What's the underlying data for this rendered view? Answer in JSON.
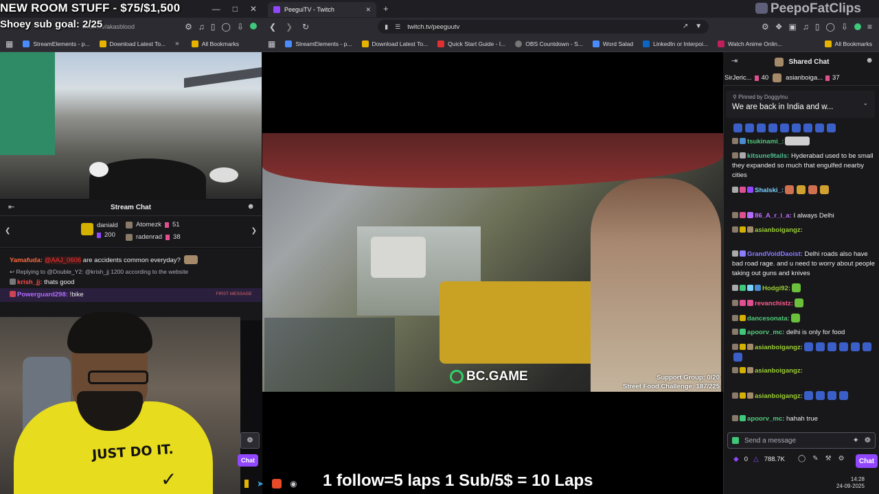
{
  "left_window": {
    "title_overlay_line1": "NEW ROOM STUFF - $75/$1,500",
    "title_overlay_line2": "Shoey sub goal: 2/25",
    "address": "twitch.tv/akasblood",
    "bookmarks": [
      "StreamElements - p...",
      "Download Latest To...",
      "All Bookmarks"
    ],
    "chat_header": "Stream Chat",
    "leaderboard": [
      {
        "name": "daniald",
        "count": "200"
      },
      {
        "name": "Atomezk",
        "count": "51"
      },
      {
        "name": "radenrad",
        "count": "38"
      }
    ],
    "messages": [
      {
        "user": "Yamafuda:",
        "mention": "@AAJ_0606",
        "text": " are accidents common everyday?",
        "user_color": "#ff6a3d"
      },
      {
        "reply": "Replying to @Double_Y2: @krish_jj 1200 according to the website"
      },
      {
        "user": "krish_jj:",
        "text": " thats good",
        "user_color": "#ff4a4a"
      },
      {
        "user": "Powerguard298:",
        "text": " !bike",
        "user_color": "#b46cff",
        "tag": "FIRST MESSAGE"
      }
    ],
    "chat_button": "Chat"
  },
  "webcam": {
    "shirt_text": "JUST DO IT."
  },
  "bottom_overlay": "1 follow=5 laps 1 Sub/5$ = 10 Laps",
  "main_window": {
    "tab_title": "PeeguiTV - Twitch",
    "address": "twitch.tv/peeguutv",
    "bookmarks": [
      "StreamElements - p...",
      "Download Latest To...",
      "Quick Start Guide - I...",
      "OBS Countdown - S...",
      "Word Salad",
      "LinkedIn or Interpoi...",
      "Watch Anime Onlin...",
      "All Bookmarks"
    ],
    "video_brand": "BC.GAME",
    "support_group": "Support Group: 0/20",
    "street_food": "Street Food Challenge: 187/225"
  },
  "watermark": "PeepoFatClips",
  "right_chat": {
    "header": "Shared Chat",
    "leaderboard": [
      {
        "name": "SirJeric...",
        "count": "40"
      },
      {
        "name": "asianboiga...",
        "count": "37"
      }
    ],
    "pinned_by": "Pinned by DoggyInu",
    "pinned_text": "We are back in India and w...",
    "messages": [
      {
        "user": "tsukinami_:",
        "text": "",
        "color": "#52c87a"
      },
      {
        "user": "kitsune9tails:",
        "text": " Hyderabad used to be small they expanded so much that engulfed nearby cities",
        "color": "#4fbf8f"
      },
      {
        "user": "Shalski_:",
        "text": "",
        "color": "#7ad3ff"
      },
      {
        "user": "86_A_r_i_a:",
        "text": " I always Delhi",
        "color": "#c26dff"
      },
      {
        "user": "asianboigangz:",
        "text": "",
        "color": "#9acd32"
      },
      {
        "user": "GrandVoidDaoist:",
        "text": " Delhi roads also have bad road rage. and u need to worry about people taking out guns and knives",
        "color": "#8a7dff"
      },
      {
        "user": "Hodgi92:",
        "text": "",
        "color": "#9acd32"
      },
      {
        "user": "revanchistz:",
        "text": "",
        "color": "#ff5a8a"
      },
      {
        "user": "dancesonata:",
        "text": "",
        "color": "#52c87a"
      },
      {
        "user": "apoorv_mc:",
        "text": " delhi is only for food",
        "color": "#52c87a"
      },
      {
        "user": "asianboigangz:",
        "text": "",
        "color": "#9acd32"
      },
      {
        "user": "asianboigangz:",
        "text": "",
        "color": "#9acd32"
      },
      {
        "user": "asianboigangz:",
        "text": "",
        "color": "#9acd32"
      },
      {
        "user": "apoorv_mc:",
        "text": " hahah true",
        "color": "#52c87a"
      }
    ],
    "send_placeholder": "Send a message",
    "points": "0",
    "viewers": "788.7K",
    "chat_button": "Chat"
  },
  "clock": {
    "time": "14:28",
    "date": "24-09-2025"
  },
  "colors": {
    "twitch_purple": "#9147ff",
    "chat_bg": "#18181b"
  }
}
